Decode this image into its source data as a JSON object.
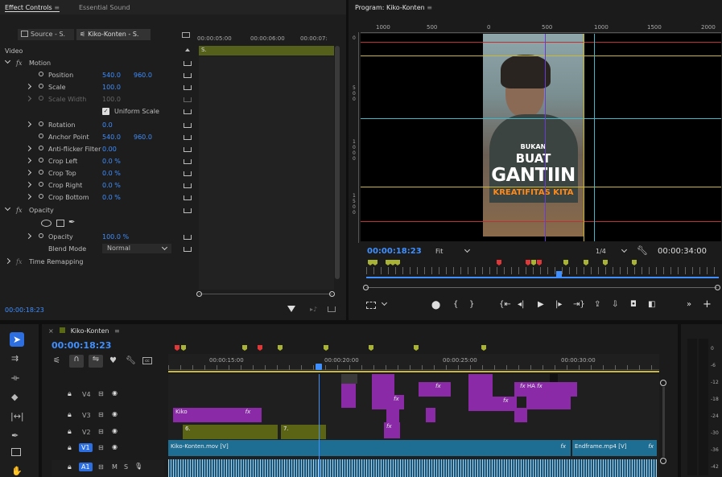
{
  "effect_controls": {
    "tab_label": "Effect Controls",
    "tab2_label": "Essential Sound",
    "source_label": "Source - S.",
    "clip_label": "Kiko-Konten - S.",
    "timecodes": [
      "00:00:05:00",
      "00:00:06:00",
      "00:00:07:"
    ],
    "clip_bar": "S.",
    "video_label": "Video",
    "motion": "Motion",
    "rows": [
      {
        "label": "Position",
        "v1": "540.0",
        "v2": "960.0"
      },
      {
        "label": "Scale",
        "v1": "100.0"
      },
      {
        "label": "Scale Width",
        "v1": "100.0"
      },
      {
        "label": "Uniform Scale"
      },
      {
        "label": "Rotation",
        "v1": "0.0"
      },
      {
        "label": "Anchor Point",
        "v1": "540.0",
        "v2": "960.0"
      },
      {
        "label": "Anti-flicker Filter",
        "v1": "0.00"
      },
      {
        "label": "Crop Left",
        "v1": "0.0 %"
      },
      {
        "label": "Crop Top",
        "v1": "0.0 %"
      },
      {
        "label": "Crop Right",
        "v1": "0.0 %"
      },
      {
        "label": "Crop Bottom",
        "v1": "0.0 %"
      }
    ],
    "opacity_header": "Opacity",
    "opacity_label": "Opacity",
    "opacity_value": "100.0 %",
    "blend_label": "Blend Mode",
    "blend_value": "Normal",
    "time_remap": "Time Remapping",
    "footer_time": "00:00:18:23"
  },
  "program": {
    "title": "Program: Kiko-Konten",
    "ruler": [
      "1000",
      "500",
      "0",
      "500",
      "1000",
      "1500",
      "2000"
    ],
    "text_top": "BUKAN",
    "text_mid": "BUAT",
    "text_big": "GANTIIN",
    "text_orange": "KREATIFITAS KITA",
    "timecode": "00:00:18:23",
    "fit": "Fit",
    "ratio": "1/4",
    "duration": "00:00:34:00"
  },
  "timeline": {
    "title": "Kiko-Konten",
    "timecode": "00:00:18:23",
    "ruler": [
      "00:00:15:00",
      "00:00:20:00",
      "00:00:25:00",
      "00:00:30:00"
    ],
    "tracks": [
      "V4",
      "V3",
      "V2",
      "V1",
      "A1"
    ],
    "a1_m": "M",
    "a1_s": "S",
    "clips": {
      "kiko": "Kiko",
      "c6": "6.",
      "c7": "7.",
      "v1_main": "Kiko-Konten.mov [V]",
      "v1_end": "Endframe.mp4 [V]",
      "ha": "HA",
      "fx": "fx"
    },
    "meter": [
      "0",
      "-6",
      "-12",
      "-18",
      "-24",
      "-30",
      "-36",
      "-42"
    ]
  },
  "colors": {
    "accent": "#3f8fff",
    "clip_purple": "#8a2aa7",
    "clip_olive": "#5a6414",
    "clip_teal": "#1e6d93",
    "playhead": "#3f8fff"
  }
}
